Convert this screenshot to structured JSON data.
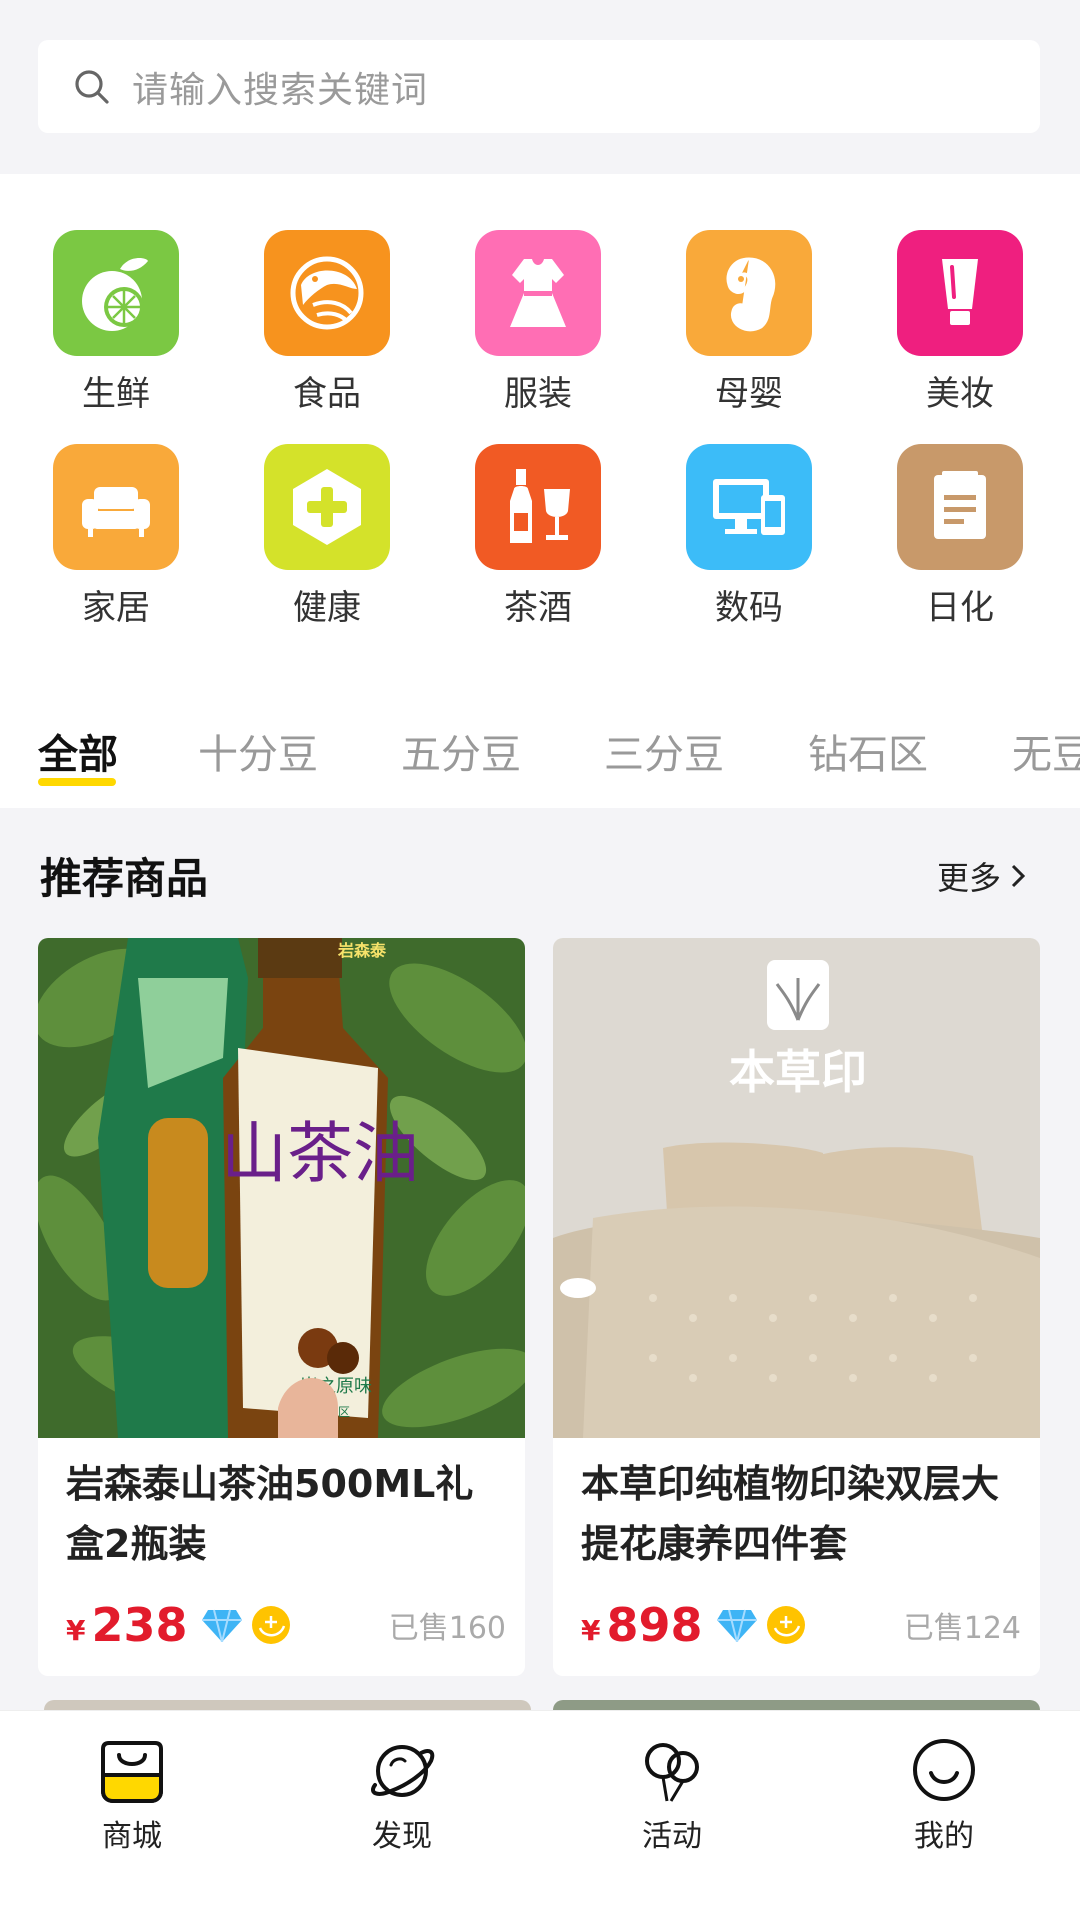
{
  "search": {
    "placeholder": "请输入搜索关键词"
  },
  "categories": [
    {
      "label": "生鲜",
      "icon": "fruit-icon",
      "color": "#7bc843"
    },
    {
      "label": "食品",
      "icon": "shrimp-icon",
      "color": "#f7931e"
    },
    {
      "label": "服装",
      "icon": "dress-icon",
      "color": "#ff6eb4"
    },
    {
      "label": "母婴",
      "icon": "baby-icon",
      "color": "#f9a93a"
    },
    {
      "label": "美妆",
      "icon": "cosmetics-icon",
      "color": "#ef1f7f"
    },
    {
      "label": "家居",
      "icon": "sofa-icon",
      "color": "#f9a93a"
    },
    {
      "label": "健康",
      "icon": "health-cross-icon",
      "color": "#d4e22a"
    },
    {
      "label": "茶酒",
      "icon": "wine-icon",
      "color": "#f15a24"
    },
    {
      "label": "数码",
      "icon": "devices-icon",
      "color": "#3cbcf8"
    },
    {
      "label": "日化",
      "icon": "document-icon",
      "color": "#c8996a"
    }
  ],
  "tabs": [
    {
      "label": "全部",
      "active": true
    },
    {
      "label": "十分豆",
      "active": false
    },
    {
      "label": "五分豆",
      "active": false
    },
    {
      "label": "三分豆",
      "active": false
    },
    {
      "label": "钻石区",
      "active": false
    },
    {
      "label": "无豆",
      "active": false
    }
  ],
  "recommend": {
    "title": "推荐商品",
    "more": "更多"
  },
  "products": [
    {
      "name": "岩森泰山茶油500ML礼盒2瓶装",
      "currency": "¥",
      "price": "238",
      "sold": "已售160",
      "image_text": "山茶油",
      "image_brand": "岩森泰",
      "image_sub": "岩之原味",
      "image_origin": "来自革命老区"
    },
    {
      "name": "本草印纯植物印染双层大提花康养四件套",
      "currency": "¥",
      "price": "898",
      "sold": "已售124",
      "image_text": "本草印"
    }
  ],
  "bottom_nav": [
    {
      "label": "商城",
      "icon": "shop-bag-icon",
      "active": true
    },
    {
      "label": "发现",
      "icon": "planet-icon",
      "active": false
    },
    {
      "label": "活动",
      "icon": "balloons-icon",
      "active": false
    },
    {
      "label": "我的",
      "icon": "smile-icon",
      "active": false
    }
  ],
  "colors": {
    "accent": "#ffd800",
    "price": "#e21b2c"
  }
}
